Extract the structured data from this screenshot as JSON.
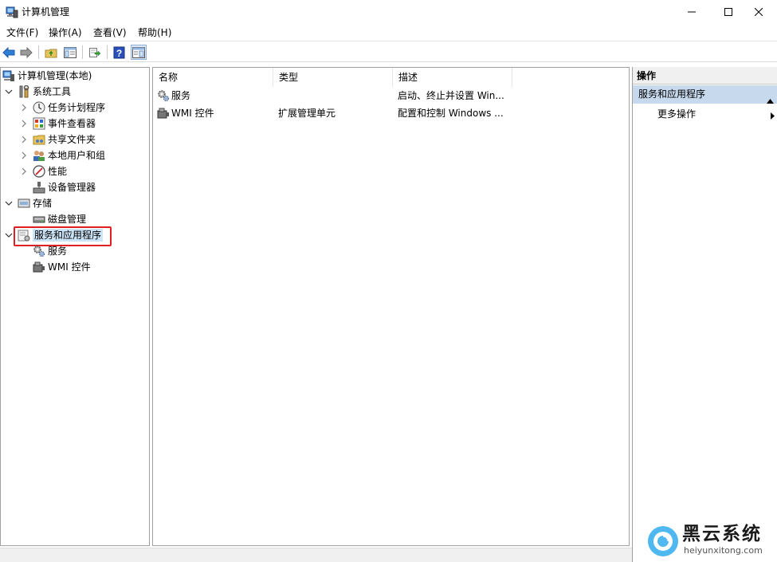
{
  "window": {
    "title": "计算机管理"
  },
  "menu": [
    "文件(F)",
    "操作(A)",
    "查看(V)",
    "帮助(H)"
  ],
  "toolbar": {
    "icons": [
      "back-arrow-icon",
      "forward-arrow-icon",
      "up-folder-icon",
      "show-hide-tree-icon",
      "export-list-icon",
      "help-icon",
      "show-hide-action-pane-icon"
    ]
  },
  "tree": {
    "root": "计算机管理(本地)",
    "system_tools": "系统工具",
    "task_scheduler": "任务计划程序",
    "event_viewer": "事件查看器",
    "shared_folders": "共享文件夹",
    "local_users": "本地用户和组",
    "performance": "性能",
    "device_manager": "设备管理器",
    "storage": "存储",
    "disk_management": "磁盘管理",
    "services_apps": "服务和应用程序",
    "services": "服务",
    "wmi": "WMI 控件"
  },
  "list": {
    "columns": [
      "名称",
      "类型",
      "描述"
    ],
    "rows": [
      {
        "name": "服务",
        "type": "",
        "desc": "启动、终止并设置 Win..."
      },
      {
        "name": "WMI 控件",
        "type": "扩展管理单元",
        "desc": "配置和控制 Windows ..."
      }
    ]
  },
  "actions": {
    "header": "操作",
    "section": "服务和应用程序",
    "more": "更多操作"
  },
  "watermark": {
    "name": "黑云系统",
    "url": "heiyunxitong.com"
  },
  "colors": {
    "selection": "#cce4f7",
    "actions_section": "#c7d9ed",
    "highlight": "#e02020",
    "accent_blue": "#1f6fd0"
  }
}
